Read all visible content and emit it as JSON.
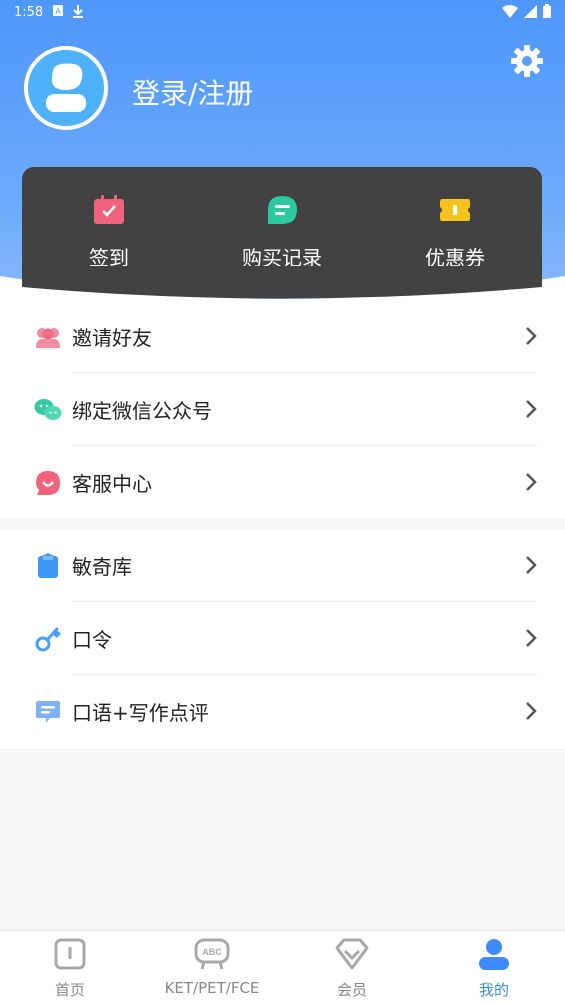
{
  "status_bar": {
    "time": "1:58"
  },
  "profile": {
    "login_label": "登录/注册"
  },
  "quick_actions": [
    {
      "label": "签到",
      "icon": "calendar-check-icon",
      "color": "#f0627d"
    },
    {
      "label": "购买记录",
      "icon": "chat-bubble-icon",
      "color": "#2bc9a0"
    },
    {
      "label": "优惠券",
      "icon": "ticket-icon",
      "color": "#f6c21e"
    }
  ],
  "section1": [
    {
      "label": "邀请好友",
      "icon": "users-icon"
    },
    {
      "label": "绑定微信公众号",
      "icon": "wechat-icon"
    },
    {
      "label": "客服中心",
      "icon": "headset-icon"
    }
  ],
  "section2": [
    {
      "label": "敏奇库",
      "icon": "book-icon"
    },
    {
      "label": "口令",
      "icon": "key-icon"
    },
    {
      "label": "口语+写作点评",
      "icon": "message-icon"
    }
  ],
  "bottom_nav": [
    {
      "label": "首页",
      "icon": "home-icon",
      "active": false
    },
    {
      "label": "KET/PET/FCE",
      "icon": "abc-icon",
      "active": false
    },
    {
      "label": "会员",
      "icon": "diamond-icon",
      "active": false
    },
    {
      "label": "我的",
      "icon": "profile-icon",
      "active": true
    }
  ],
  "colors": {
    "primary": "#4f97fb",
    "panel": "#424242",
    "active_nav": "#3d8bf8"
  }
}
